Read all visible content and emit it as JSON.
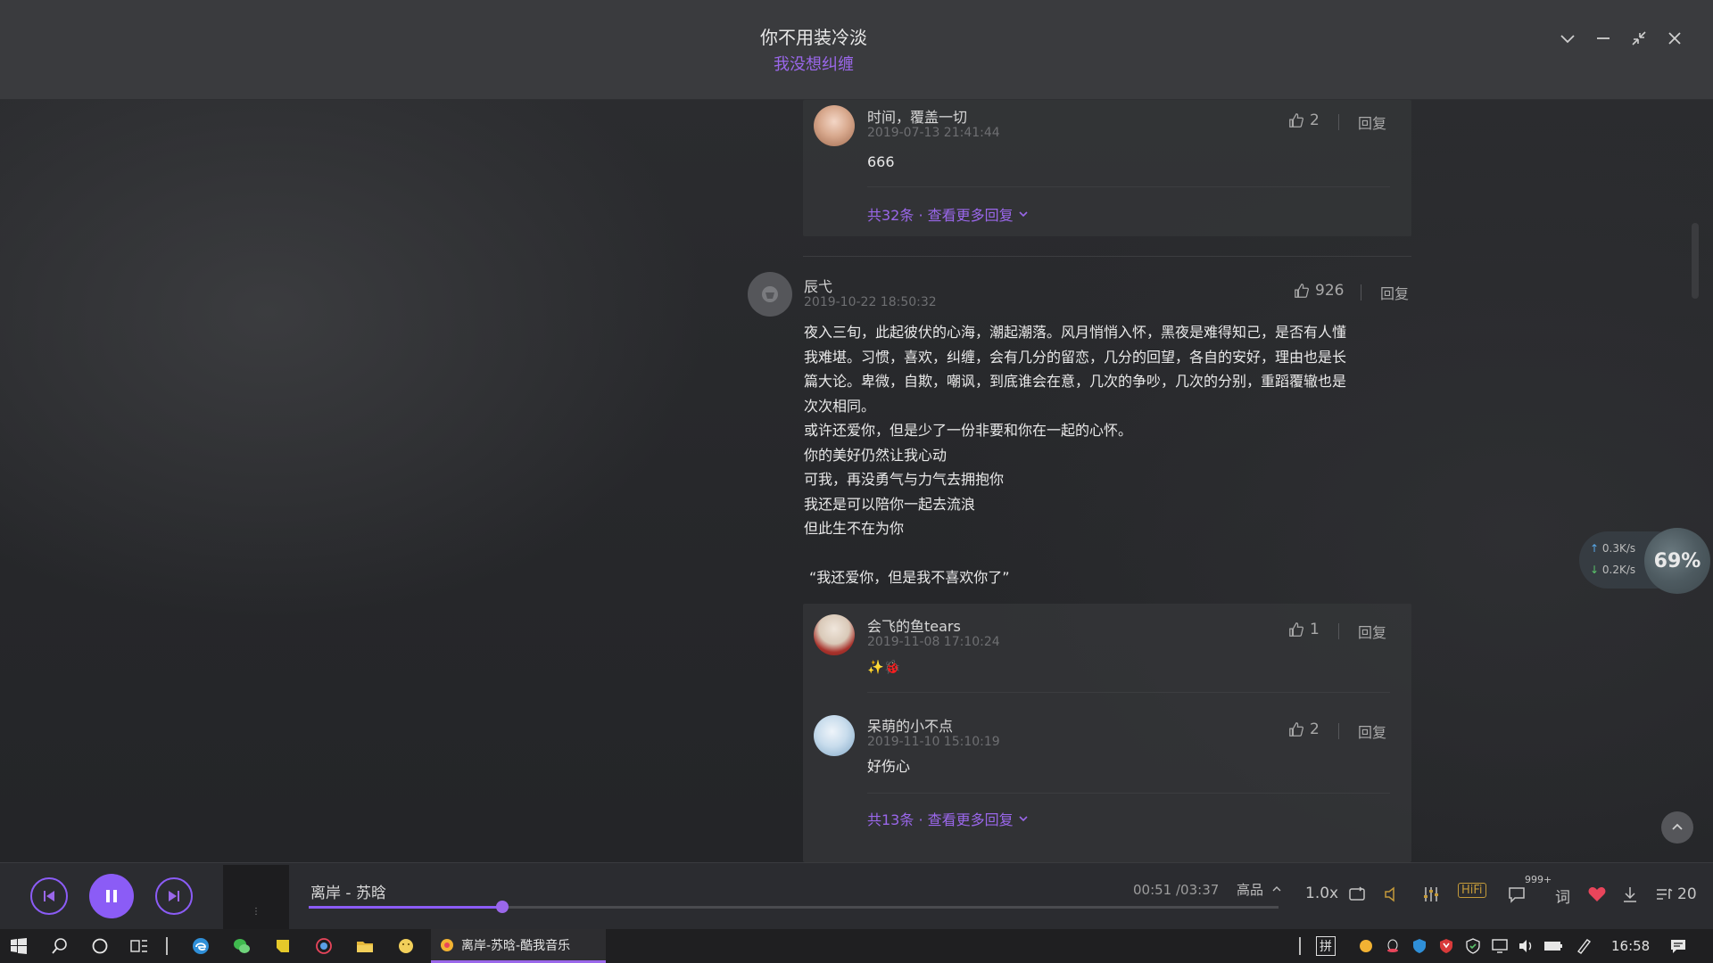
{
  "header": {
    "song_title": "你不用装冷淡",
    "song_subtitle": "我没想纠缠"
  },
  "comments": {
    "reply_group_1": {
      "reply": {
        "name": "时间，覆盖一切",
        "time": "2019-07-13 21:41:44",
        "text": "666",
        "likes": "2",
        "reply_label": "回复"
      },
      "more_label": "共32条 · 查看更多回复"
    },
    "main": {
      "name": "辰弋",
      "time": "2019-10-22 18:50:32",
      "likes": "926",
      "reply_label": "回复",
      "paragraphs": [
        "夜入三旬，此起彼伏的心海，潮起潮落。风月悄悄入怀，黑夜是难得知己，是否有人懂",
        "我难堪。习惯，喜欢，纠缠，会有几分的留恋，几分的回望，各自的安好，理由也是长",
        "篇大论。卑微，自欺，嘲讽，到底谁会在意，几次的争吵，几次的分别，重蹈覆辙也是",
        "次次相同。",
        "或许还爱你，但是少了一份非要和你在一起的心怀。",
        "你的美好仍然让我心动",
        "可我，再没勇气与力气去拥抱你",
        "我还是可以陪你一起去流浪",
        "但此生不在为你",
        "“我还爱你，但是我不喜欢你了”"
      ]
    },
    "reply_group_2": {
      "replies": [
        {
          "name": "会飞的鱼tears",
          "time": "2019-11-08 17:10:24",
          "text": "✨🐞",
          "likes": "1",
          "reply_label": "回复"
        },
        {
          "name": "呆萌的小不点",
          "time": "2019-11-10 15:10:19",
          "text": "好伤心",
          "likes": "2",
          "reply_label": "回复"
        }
      ],
      "more_label": "共13条 · 查看更多回复"
    }
  },
  "speed_widget": {
    "upload": "0.3K/s",
    "download": "0.2K/s",
    "percent": "69%"
  },
  "player": {
    "track": "离岸 - 苏晗",
    "elapsed": "00:51",
    "duration": "03:37",
    "time_display": "00:51 /03:37",
    "quality": "高品",
    "speed": "1.0x",
    "hifi": "HiFi",
    "comment_count": "999+",
    "lyric_label": "词",
    "playlist_count": "20",
    "progress_fraction": 0.2
  },
  "taskbar": {
    "app_label": "离岸-苏晗-酷我音乐",
    "ime": "拼",
    "clock": "16:58"
  },
  "colors": {
    "accent": "#9a67ea",
    "heart": "#e8455b"
  }
}
